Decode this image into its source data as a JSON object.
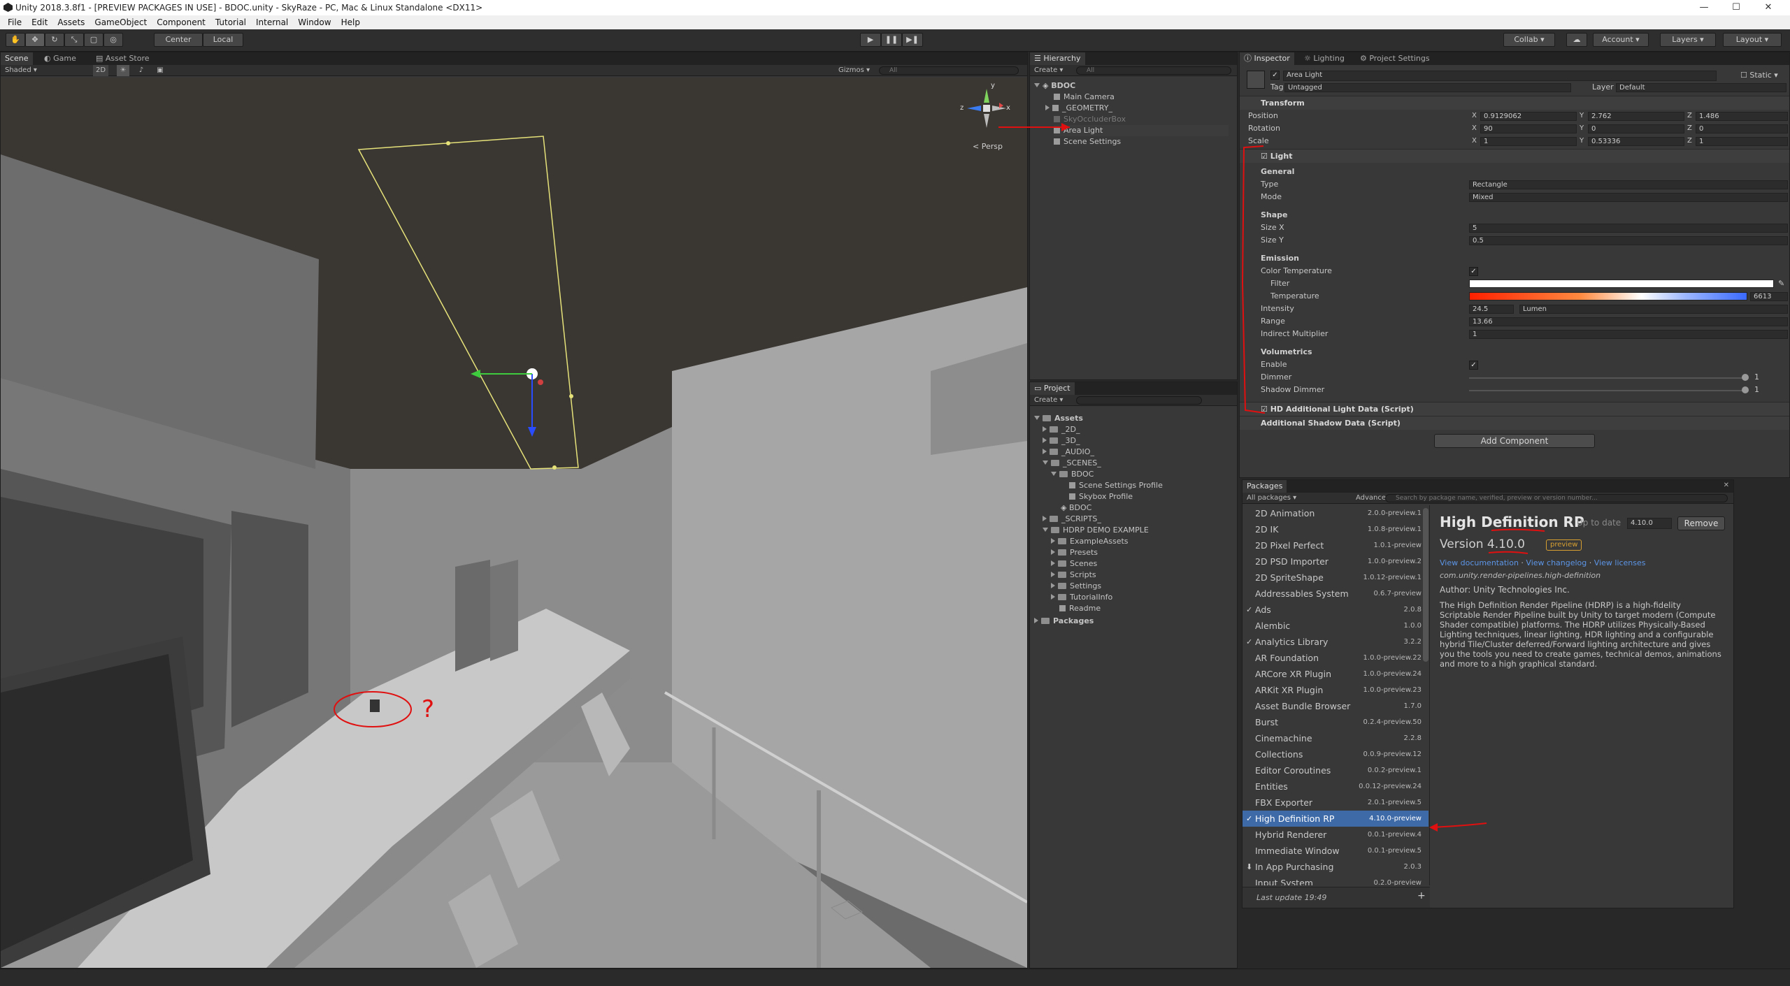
{
  "window": {
    "title": "Unity 2018.3.8f1 - [PREVIEW PACKAGES IN USE] - BDOC.unity - SkyRaze - PC, Mac & Linux Standalone <DX11>",
    "minimize": "—",
    "maximize": "☐",
    "close": "✕"
  },
  "menu": [
    "File",
    "Edit",
    "Assets",
    "GameObject",
    "Component",
    "Tutorial",
    "Internal",
    "Window",
    "Help"
  ],
  "toolbar": {
    "pivot": "Center",
    "space": "Local",
    "collab": "Collab ▾",
    "account": "Account",
    "layers": "Layers",
    "layout": "Layout"
  },
  "scene": {
    "tabs": [
      "Scene",
      "Game",
      "Asset Store"
    ],
    "shading": "Shaded",
    "mode2d": "2D",
    "gizmos": "Gizmos ▾",
    "search_placeholder": "All",
    "persp": "< Persp",
    "gizmo_axes": {
      "x": "x",
      "y": "y",
      "z": "z"
    },
    "annotation": "?"
  },
  "hierarchy": {
    "tab": "Hierarchy",
    "create": "Create ▾",
    "search_placeholder": "All",
    "scene_name": "BDOC",
    "items": [
      "Main Camera",
      "_GEOMETRY_",
      "SkyOccluderBox",
      "Area Light",
      "Scene Settings"
    ]
  },
  "project": {
    "tab": "Project",
    "create": "Create ▾",
    "items": [
      "Assets",
      "_2D_",
      "_3D_",
      "_AUDIO_",
      "_SCENES_",
      "BDOC",
      "Scene Settings Profile",
      "Skybox Profile",
      "BDOC",
      "_SCRIPTS_",
      "HDRP DEMO EXAMPLE",
      "ExampleAssets",
      "Presets",
      "Scenes",
      "Scripts",
      "Settings",
      "TutorialInfo",
      "Readme",
      "Packages"
    ]
  },
  "inspector": {
    "tabs": [
      "Inspector",
      "Lighting",
      "Project Settings"
    ],
    "object_name": "Area Light",
    "static": "Static ▾",
    "tag_label": "Tag",
    "tag_value": "Untagged",
    "layer_label": "Layer",
    "layer_value": "Default",
    "transform": {
      "title": "Transform",
      "position_label": "Position",
      "pos_x": "0.9129062",
      "pos_y": "2.762",
      "pos_z": "1.486",
      "rotation_label": "Rotation",
      "rot_x": "90",
      "rot_y": "0",
      "rot_z": "0",
      "scale_label": "Scale",
      "scl_x": "1",
      "scl_y": "0.53336",
      "scl_z": "1",
      "x": "X",
      "y": "Y",
      "z": "Z"
    },
    "light": {
      "title": "Light",
      "general": "General",
      "type_label": "Type",
      "type_value": "Rectangle",
      "mode_label": "Mode",
      "mode_value": "Mixed",
      "shape": "Shape",
      "sizex_label": "Size X",
      "sizex_value": "5",
      "sizey_label": "Size Y",
      "sizey_value": "0.5",
      "emission": "Emission",
      "colortemp_label": "Color Temperature",
      "filter_label": "Filter",
      "temperature_label": "Temperature",
      "temperature_value": "6613",
      "intensity_label": "Intensity",
      "intensity_value": "24.5",
      "intensity_unit": "Lumen",
      "range_label": "Range",
      "range_value": "13.66",
      "indirect_label": "Indirect Multiplier",
      "indirect_value": "1",
      "volumetrics": "Volumetrics",
      "enable_label": "Enable",
      "dimmer_label": "Dimmer",
      "dimmer_value": "1",
      "shadowdimmer_label": "Shadow Dimmer",
      "shadowdimmer_value": "1"
    },
    "hd_light_data": "HD Additional Light Data (Script)",
    "shadow_data": "Additional Shadow Data (Script)",
    "add_component": "Add Component"
  },
  "packages": {
    "tab": "Packages",
    "filter": "All packages ▾",
    "advanced": "Advanced ▾",
    "search_placeholder": "Search by package name, verified, preview or version number...",
    "list": [
      {
        "name": "2D Animation",
        "version": "2.0.0-preview.1",
        "check": ""
      },
      {
        "name": "2D IK",
        "version": "1.0.8-preview.1",
        "check": ""
      },
      {
        "name": "2D Pixel Perfect",
        "version": "1.0.1-preview",
        "check": ""
      },
      {
        "name": "2D PSD Importer",
        "version": "1.0.0-preview.2",
        "check": ""
      },
      {
        "name": "2D SpriteShape",
        "version": "1.0.12-preview.1",
        "check": ""
      },
      {
        "name": "Addressables System",
        "version": "0.6.7-preview",
        "check": ""
      },
      {
        "name": "Ads",
        "version": "2.0.8",
        "check": "✓"
      },
      {
        "name": "Alembic",
        "version": "1.0.0",
        "check": ""
      },
      {
        "name": "Analytics Library",
        "version": "3.2.2",
        "check": "✓"
      },
      {
        "name": "AR Foundation",
        "version": "1.0.0-preview.22",
        "check": ""
      },
      {
        "name": "ARCore XR Plugin",
        "version": "1.0.0-preview.24",
        "check": ""
      },
      {
        "name": "ARKit XR Plugin",
        "version": "1.0.0-preview.23",
        "check": ""
      },
      {
        "name": "Asset Bundle Browser",
        "version": "1.7.0",
        "check": ""
      },
      {
        "name": "Burst",
        "version": "0.2.4-preview.50",
        "check": ""
      },
      {
        "name": "Cinemachine",
        "version": "2.2.8",
        "check": ""
      },
      {
        "name": "Collections",
        "version": "0.0.9-preview.12",
        "check": ""
      },
      {
        "name": "Editor Coroutines",
        "version": "0.0.2-preview.1",
        "check": ""
      },
      {
        "name": "Entities",
        "version": "0.0.12-preview.24",
        "check": ""
      },
      {
        "name": "FBX Exporter",
        "version": "2.0.1-preview.5",
        "check": ""
      },
      {
        "name": "High Definition RP",
        "version": "4.10.0-preview",
        "check": "✓"
      },
      {
        "name": "Hybrid Renderer",
        "version": "0.0.1-preview.4",
        "check": ""
      },
      {
        "name": "Immediate Window",
        "version": "0.0.1-preview.5",
        "check": ""
      },
      {
        "name": "In App Purchasing",
        "version": "2.0.3",
        "check": "⬇"
      },
      {
        "name": "Input System",
        "version": "0.2.0-preview",
        "check": ""
      }
    ],
    "last_update": "Last update 19:49",
    "detail": {
      "title": "High Definition RP",
      "status": "Up to date",
      "version_select": "4.10.0",
      "remove": "Remove",
      "version_label": "Version 4.10.0",
      "preview_badge": "preview",
      "link_docs": "View documentation",
      "link_changelog": "View changelog",
      "link_licenses": "View licenses",
      "sep": "·",
      "package_id": "com.unity.render-pipelines.high-definition",
      "author": "Author: Unity Technologies Inc.",
      "description": "The High Definition Render Pipeline (HDRP) is a high-fidelity Scriptable Render Pipeline built by Unity to target modern (Compute Shader compatible) platforms. The HDRP utilizes Physically-Based Lighting techniques, linear lighting, HDR lighting and a configurable hybrid Tile/Cluster deferred/Forward lighting architecture and gives you the tools you need to create games, technical demos, animations and more to a high graphical standard."
    }
  },
  "colors": {
    "accent_blue": "#3e6aa8",
    "annotation_red": "#e01010",
    "preview_badge": "#d8a030",
    "link": "#5c95e6",
    "area_light_outline": "#e6e27a"
  }
}
